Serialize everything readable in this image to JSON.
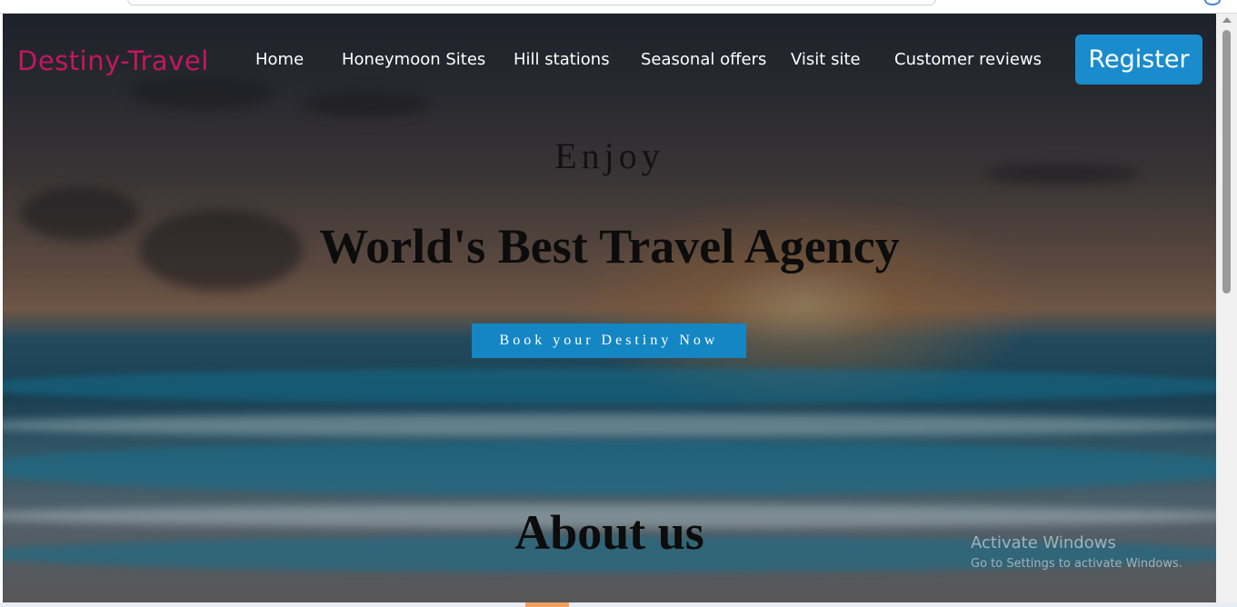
{
  "brand": "Destiny-Travel",
  "nav": {
    "items": [
      {
        "label": "Home"
      },
      {
        "label": "Honeymoon Sites"
      },
      {
        "label": "Hill stations"
      },
      {
        "label": "Seasonal offers"
      },
      {
        "label": "Visit site"
      },
      {
        "label": "Customer reviews"
      }
    ],
    "register_label": "Register"
  },
  "hero": {
    "subtitle": "Enjoy",
    "title": "World's Best Travel Agency",
    "cta_label": "Book your Destiny Now"
  },
  "about": {
    "title": "About us"
  },
  "watermark": {
    "title": "Activate Windows",
    "subtitle": "Go to Settings to activate Windows."
  },
  "colors": {
    "brand": "#c4175f",
    "button": "#1a8ccd",
    "nav_text": "#ffffff"
  }
}
